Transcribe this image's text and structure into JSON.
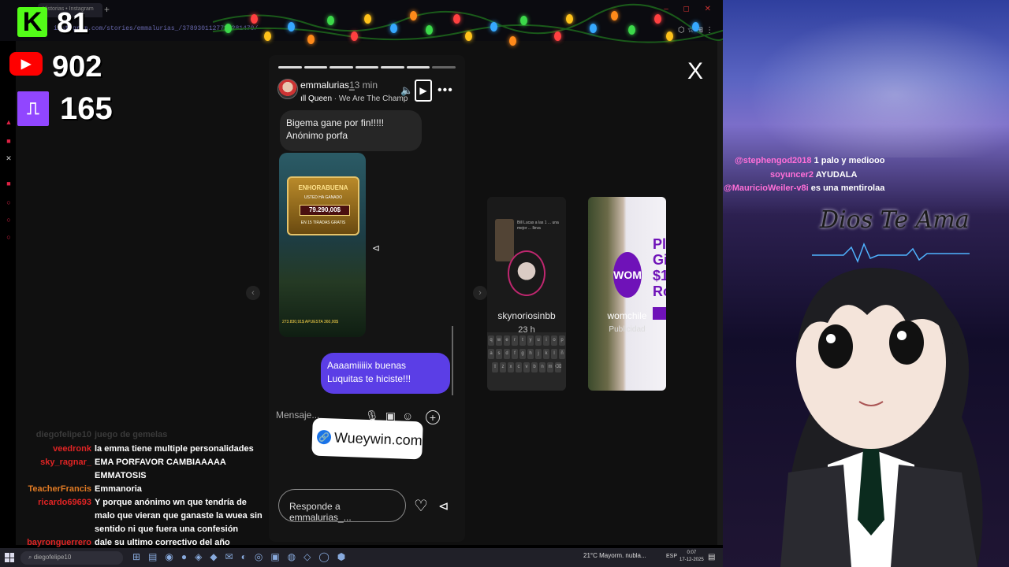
{
  "browser": {
    "tab_title": "Historias • Instagram",
    "new_tab": "+",
    "url": "instagram.com/stories/emmalurias_/3789301127725281470/"
  },
  "overlay_counters": {
    "kick": {
      "icon": "K",
      "count": "81"
    },
    "youtube": {
      "icon": "▶",
      "count": "902"
    },
    "twitch": {
      "icon": "⎍",
      "count": "165"
    }
  },
  "story": {
    "username": "emmalurias_",
    "time_ago": "13 min",
    "music_artist": "Queen",
    "music_track": " · We Are The Champ",
    "progress_segments": 7,
    "progress_done": 6,
    "message_in": "Bigema gane por fin!!!!! Anónimo porfa",
    "game": {
      "title": "ENHORABUENA",
      "subtitle": "USTED HA GANADO",
      "amount": "79.290,00$",
      "free_spins": "EN 15 TIRADAS GRATIS",
      "stats": "273.830,91$   APUESTA 360,00$"
    },
    "message_out": "Aaaamiiiiix buenas Luquitas te hiciste!!!",
    "message_placeholder": "Mensaje...",
    "reply_placeholder": "Responde a emmalurias_...",
    "close_label": "X"
  },
  "sticker": {
    "text": "Wueywin.com"
  },
  "previews": [
    {
      "user": "skynoriosinbb",
      "time": "23 h",
      "text": "Bill Lucas a las 1 ... una mejor ... lleva"
    },
    {
      "user": "womchile",
      "sub": "Publicidad",
      "logo": "WOM",
      "side": "Pla Gi $10 Ro"
    }
  ],
  "right_chat": [
    {
      "user": "@stephengod2018",
      "msg": "1 palo y mediooo"
    },
    {
      "user": "soyuncer2",
      "msg": "AYUDALA"
    },
    {
      "user": "@MauricioWeiler-v8i",
      "msg": "es una mentirolaa"
    }
  ],
  "right_banner": "Dios Te Ama",
  "left_chat": [
    {
      "user": "diegofelipe10",
      "msg": "juego de gemelas",
      "color": "#3a3a3a"
    },
    {
      "user": "veedronk",
      "msg": "la emma tiene multiple personalidades",
      "color": "#e02424"
    },
    {
      "user": "sky_ragnar_",
      "msg": "EMA PORFAVOR CAMBIAAAAA",
      "color": "#e02424"
    },
    {
      "user": "",
      "msg": "EMMATOSIS",
      "color": "#3a5bd9"
    },
    {
      "user": "TeacherFrancis",
      "msg": "Emmanoria",
      "color": "#e07a24"
    },
    {
      "user": "ricardo69693",
      "msg": "Y porque anónimo wn que tendría de",
      "color": "#e02424"
    },
    {
      "user": "",
      "msg": "malo que vieran que ganaste la wuea sin",
      "color": "#e02424"
    },
    {
      "user": "",
      "msg": "sentido ni que fuera una confesión",
      "color": "#e02424"
    },
    {
      "user": "bayronguerrero",
      "msg": "dale su ultimo correctivo del año",
      "color": "#e02424"
    }
  ],
  "taskbar": {
    "search": "diegofelipe10",
    "weather": "21°C  Mayorm. nubla...",
    "lang": "ESP",
    "time": "0:07",
    "date": "17-12-2025"
  },
  "colors": {
    "ig_purple": "#5b3ee6",
    "kick_green": "#53fc18",
    "youtube_red": "#ff0000",
    "twitch_purple": "#9146ff",
    "wom_purple": "#6f12b8"
  }
}
